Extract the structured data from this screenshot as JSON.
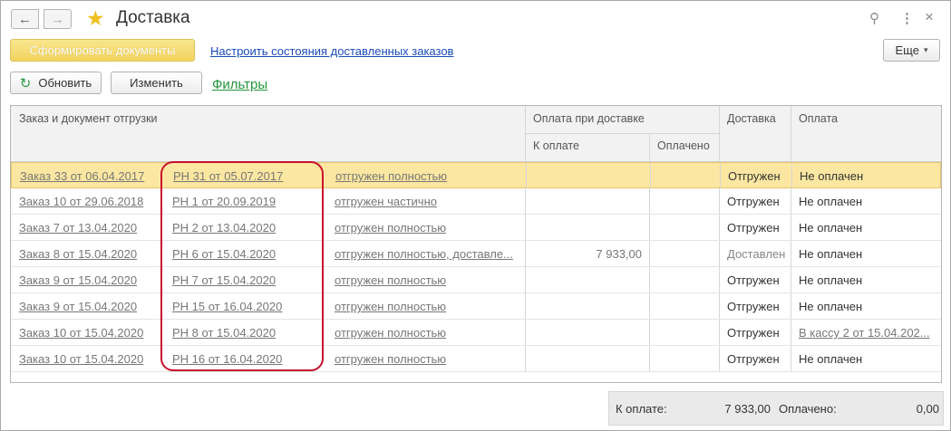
{
  "window": {
    "title": "Доставка",
    "back_icon": "←",
    "forward_icon": "→",
    "star_icon": "★",
    "link_icon": "⚲",
    "menu_icon": "⋮",
    "close_icon": "×"
  },
  "toolbar": {
    "generate_docs": "Сформировать документы",
    "configure_link": "Настроить состояния доставленных заказов",
    "more": "Еще",
    "more_arrow": "▾",
    "refresh": "Обновить",
    "refresh_icon": "↻",
    "edit": "Изменить",
    "filters": "Фильтры"
  },
  "table": {
    "headers": {
      "order": "Заказ и документ отгрузки",
      "payment_on_delivery": "Оплата при доставке",
      "to_pay": "К оплате",
      "paid": "Оплачено",
      "delivery": "Доставка",
      "payment": "Оплата"
    },
    "rows": [
      {
        "order": "Заказ 33 от 06.04.2017",
        "doc": "РН 31 от 05.07.2017",
        "state": "отгружен полностью",
        "to_pay": "",
        "paid": "",
        "delivery": "Отгружен",
        "payment": "Не оплачен"
      },
      {
        "order": "Заказ 10 от 29.06.2018",
        "doc": "РН 1 от 20.09.2019",
        "state": "отгружен частично",
        "to_pay": "",
        "paid": "",
        "delivery": "Отгружен",
        "payment": "Не оплачен"
      },
      {
        "order": "Заказ 7 от 13.04.2020",
        "doc": "РН 2 от 13.04.2020",
        "state": "отгружен полностью",
        "to_pay": "",
        "paid": "",
        "delivery": "Отгружен",
        "payment": "Не оплачен"
      },
      {
        "order": "Заказ 8 от 15.04.2020",
        "doc": "РН 6 от 15.04.2020",
        "state": "отгружен полностью, доставле...",
        "to_pay": "7 933,00",
        "paid": "",
        "delivery": "Доставлен",
        "payment": "Не оплачен"
      },
      {
        "order": "Заказ 9 от 15.04.2020",
        "doc": "РН 7 от 15.04.2020",
        "state": "отгружен полностью",
        "to_pay": "",
        "paid": "",
        "delivery": "Отгружен",
        "payment": "Не оплачен"
      },
      {
        "order": "Заказ 9 от 15.04.2020",
        "doc": "РН 15 от 16.04.2020",
        "state": "отгружен полностью",
        "to_pay": "",
        "paid": "",
        "delivery": "Отгружен",
        "payment": "Не оплачен"
      },
      {
        "order": "Заказ 10 от 15.04.2020",
        "doc": "РН 8 от 15.04.2020",
        "state": "отгружен полностью",
        "to_pay": "",
        "paid": "",
        "delivery": "Отгружен",
        "payment": "В кассу 2 от 15.04.202..."
      },
      {
        "order": "Заказ 10 от 15.04.2020",
        "doc": "РН 16 от 16.04.2020",
        "state": "отгружен полностью",
        "to_pay": "",
        "paid": "",
        "delivery": "Отгружен",
        "payment": "Не оплачен"
      }
    ]
  },
  "footer": {
    "to_pay_label": "К оплате:",
    "to_pay_value": "7 933,00",
    "paid_label": "Оплачено:",
    "paid_value": "0,00"
  }
}
